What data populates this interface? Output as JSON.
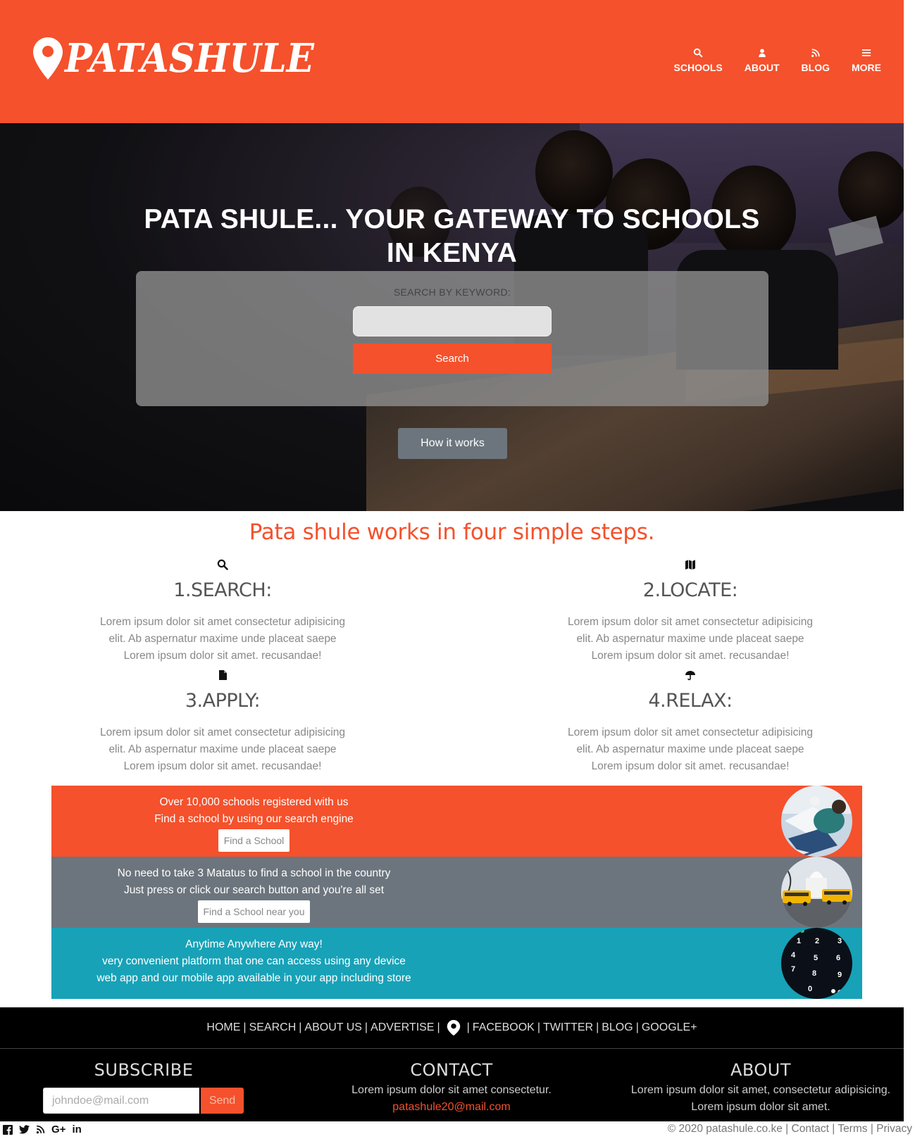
{
  "brand": {
    "name": "PATASHULE",
    "primary_color": "#f4512c"
  },
  "nav": [
    {
      "label": "SCHOOLS",
      "icon": "search-icon"
    },
    {
      "label": "ABOUT",
      "icon": "user-icon"
    },
    {
      "label": "BLOG",
      "icon": "rss-icon"
    },
    {
      "label": "MORE",
      "icon": "menu-icon"
    }
  ],
  "hero": {
    "title_line1": "PATA SHULE... YOUR GATEWAY TO SCHOOLS",
    "title_line2": "IN KENYA",
    "search_label": "SEARCH BY KEYWORD:",
    "search_value": "",
    "search_button": "Search",
    "how_button": "How it works"
  },
  "steps": {
    "title": "Pata shule works in four simple steps.",
    "items": [
      {
        "icon": "search-icon",
        "heading": "1.SEARCH:",
        "line1": "Lorem ipsum dolor sit amet consectetur adipisicing",
        "line2": "elit. Ab aspernatur maxime unde placeat saepe",
        "line3": "Lorem ipsum dolor sit amet. recusandae!"
      },
      {
        "icon": "map-icon",
        "heading": "2.LOCATE:",
        "line1": "Lorem ipsum dolor sit amet consectetur adipisicing",
        "line2": "elit. Ab aspernatur maxime unde placeat saepe",
        "line3": "Lorem ipsum dolor sit amet. recusandae!"
      },
      {
        "icon": "file-icon",
        "heading": "3.APPLY:",
        "line1": "Lorem ipsum dolor sit amet consectetur adipisicing",
        "line2": "elit. Ab aspernatur maxime unde placeat saepe",
        "line3": "Lorem ipsum dolor sit amet. recusandae!"
      },
      {
        "icon": "umbrella-icon",
        "heading": "4.RELAX:",
        "line1": "Lorem ipsum dolor sit amet consectetur adipisicing",
        "line2": "elit. Ab aspernatur maxime unde placeat saepe",
        "line3": "Lorem ipsum dolor sit amet. recusandae!"
      }
    ]
  },
  "bands": [
    {
      "color": "#f4512c",
      "line1": "Over 10,000 schools registered with us",
      "line2": "Find a school by using our search engine",
      "button": "Find a School"
    },
    {
      "color": "#6c757d",
      "line1": "No need to take 3 Matatus to find a school in the country",
      "line2": "Just press or click our search button and you're all set",
      "button": "Find a School near you"
    },
    {
      "color": "#17a2b8",
      "line1": "Anytime Anywhere Any way!",
      "line2": "very convenient platform that one can access using any device",
      "line3": "web app and our mobile app available in your app including store"
    }
  ],
  "footer": {
    "links": [
      "HOME",
      "SEARCH",
      "ABOUT US",
      "ADVERTISE",
      "FACEBOOK",
      "TWITTER",
      "BLOG",
      "GOOGLE+"
    ],
    "separator": "|",
    "subscribe": {
      "heading": "SUBSCRIBE",
      "placeholder": "johndoe@mail.com",
      "button": "Send"
    },
    "contact": {
      "heading": "CONTACT",
      "text": "Lorem ipsum dolor sit amet consectetur.",
      "email": "patashule20@mail.com"
    },
    "about": {
      "heading": "ABOUT",
      "line1": "Lorem ipsum dolor sit amet, consectetur adipisicing.",
      "line2": "Lorem ipsum dolor sit amet."
    },
    "social": [
      "facebook-icon",
      "twitter-icon",
      "rss-icon",
      "google-plus-icon",
      "linkedin-icon"
    ],
    "social_labels": {
      "google": "G+",
      "linkedin": "in"
    },
    "copyright": "© 2020 patashule.co.ke",
    "legal": [
      "Contact",
      "Terms",
      "Privacy"
    ]
  }
}
